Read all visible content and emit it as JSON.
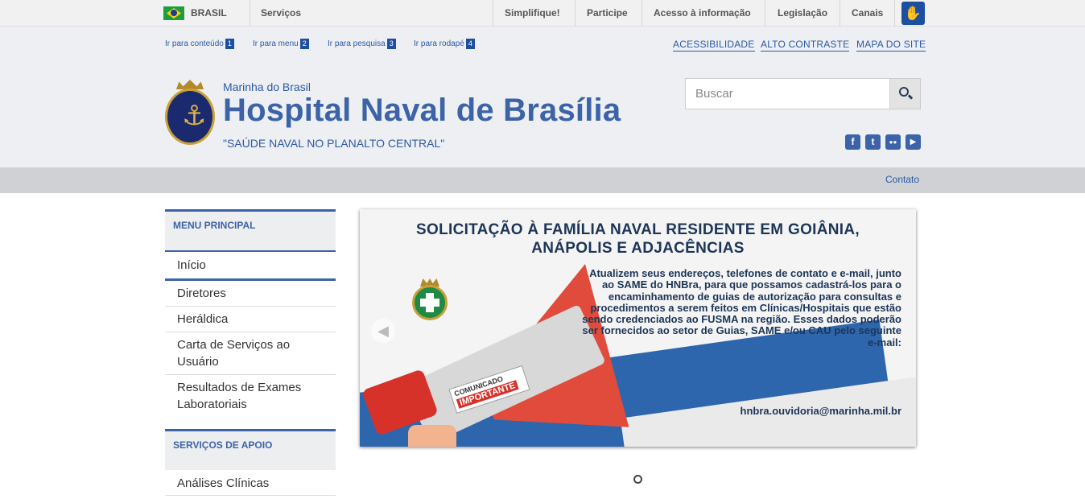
{
  "govbar": {
    "country": "BRASIL",
    "services": "Serviços",
    "links": [
      "Simplifique!",
      "Participe",
      "Acesso à informação",
      "Legislação",
      "Canais"
    ],
    "accessibility_icon": "vlibras-hands-icon"
  },
  "skip_links": [
    {
      "label": "Ir para conteúdo",
      "key": "1"
    },
    {
      "label": "Ir para menu",
      "key": "2"
    },
    {
      "label": "Ir para pesquisa",
      "key": "3"
    },
    {
      "label": "Ir para rodapé",
      "key": "4"
    }
  ],
  "top_links": [
    "ACESSIBILIDADE",
    "ALTO CONTRASTE",
    "MAPA DO SITE"
  ],
  "header": {
    "org": "Marinha do Brasil",
    "title": "Hospital Naval de Brasília",
    "slogan": "\"SAÚDE NAVAL NO PLANALTO CENTRAL\""
  },
  "search": {
    "placeholder": "Buscar",
    "value": ""
  },
  "social": [
    {
      "icon": "facebook-icon",
      "glyph": "f"
    },
    {
      "icon": "twitter-icon",
      "glyph": "t"
    },
    {
      "icon": "flickr-icon",
      "glyph": "●●"
    },
    {
      "icon": "youtube-icon",
      "glyph": "▶"
    }
  ],
  "subnav": {
    "contato": "Contato"
  },
  "sidebar": {
    "menu_principal": {
      "heading": "MENU PRINCIPAL",
      "items": [
        "Início",
        "Diretores",
        "Heráldica",
        "Carta de Serviços ao Usuário",
        "Resultados de Exames Laboratoriais"
      ]
    },
    "servicos_apoio": {
      "heading": "SERVIÇOS DE APOIO",
      "items": [
        "Análises Clínicas"
      ]
    }
  },
  "banner": {
    "heading_line1": "SOLICITAÇÃO À FAMÍLIA NAVAL RESIDENTE EM GOIÂNIA,",
    "heading_line2": "ANÁPOLIS E ADJACÊNCIAS",
    "body": "Atualizem seus endereços, telefones de contato e e-mail, junto ao SAME do HNBra, para que possamos cadastrá-los para o encaminhamento de guias de autorização para consultas e procedimentos a serem feitos em Clínicas/Hospitais que estão sendo credenciados ao FUSMA na região. Esses dados poderão ser fornecidos ao setor de Guias, SAME e/ou CAU pelo seguinte e-mail:",
    "email": "hnbra.ouvidoria@marinha.mil.br",
    "sticker_top": "COMUNICADO",
    "sticker_bottom": "IMPORTANTE"
  },
  "colors": {
    "accent": "#3c63a8",
    "link": "#2b5aa6",
    "header_bg": "#edeff2"
  }
}
